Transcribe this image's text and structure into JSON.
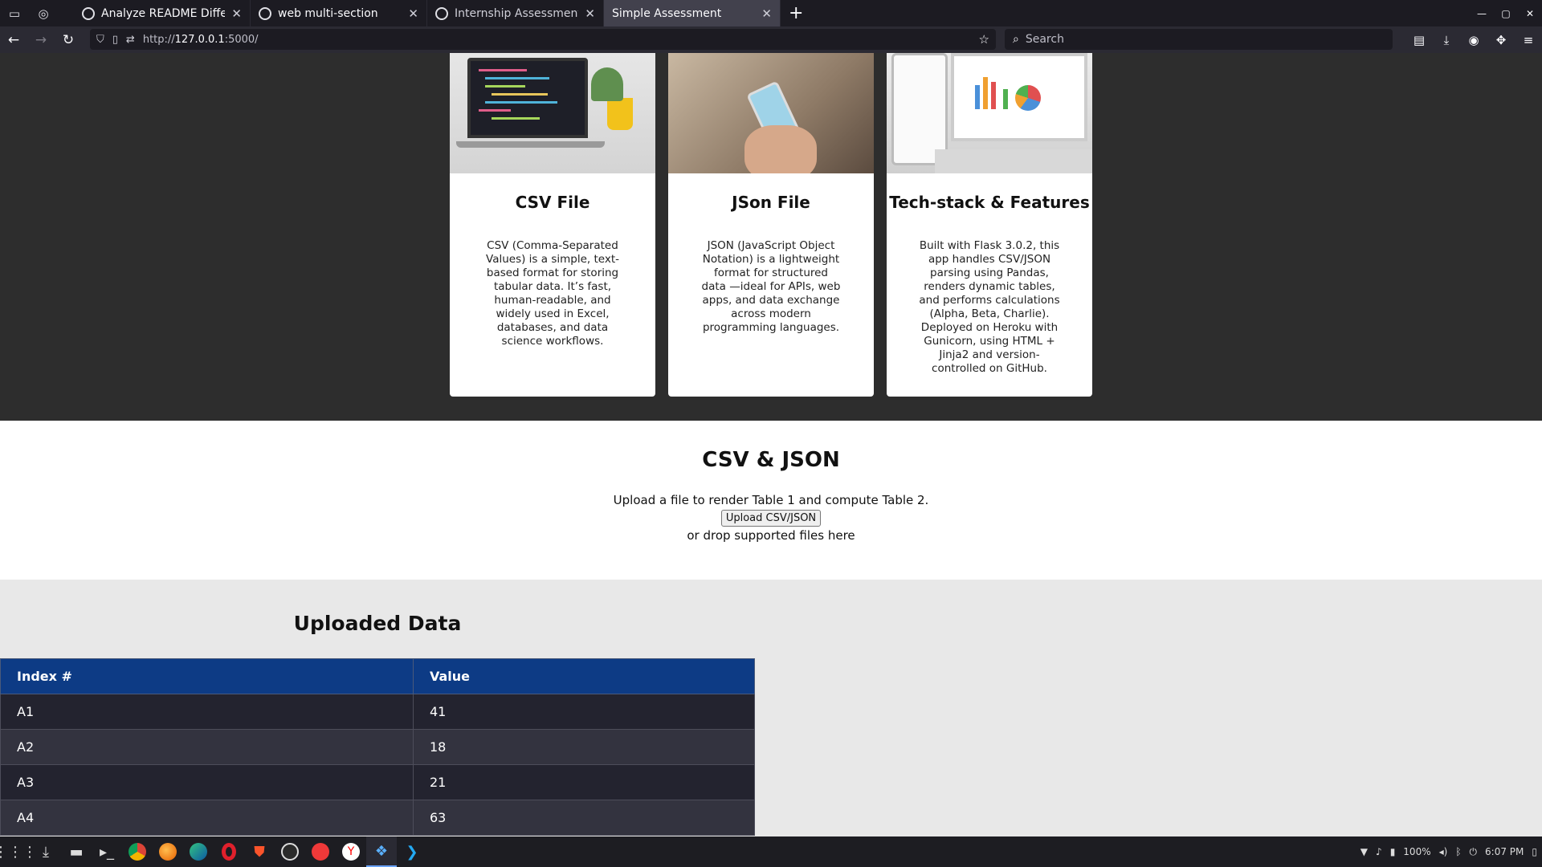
{
  "browser": {
    "tabs": [
      {
        "label": "Analyze README Differences",
        "active": false
      },
      {
        "label": "web multi-section",
        "active": false
      },
      {
        "label": "Internship Assessment Analy",
        "active": false
      },
      {
        "label": "Simple Assessment",
        "active": true
      }
    ],
    "url_prefix": "http://",
    "url_host": "127.0.0.1",
    "url_rest": ":5000/",
    "search_placeholder": "Search"
  },
  "cards": [
    {
      "title": "CSV File",
      "text": "CSV (Comma-Separated Values) is a simple, text-based format for storing tabular data. It’s fast, human-readable, and widely used in Excel, databases, and data science workflows."
    },
    {
      "title": "JSon File",
      "text": "JSON (JavaScript Object Notation) is a lightweight format for structured data —ideal for APIs, web apps, and data exchange across modern programming languages."
    },
    {
      "title": "Tech-stack & Features",
      "text": "Built with Flask 3.0.2, this app handles CSV/JSON parsing using Pandas, renders dynamic tables, and performs calculations (Alpha, Beta, Charlie). Deployed on Heroku with Gunicorn, using HTML + Jinja2 and version-controlled on GitHub."
    }
  ],
  "upload": {
    "title": "CSV & JSON",
    "description": "Upload a file to render Table 1 and compute Table 2.",
    "button_label": "Upload CSV/JSON",
    "drop_text": "or drop supported files here"
  },
  "data_table": {
    "title": "Uploaded Data",
    "columns": [
      "Index #",
      "Value"
    ],
    "rows": [
      [
        "A1",
        "41"
      ],
      [
        "A2",
        "18"
      ],
      [
        "A3",
        "21"
      ],
      [
        "A4",
        "63"
      ]
    ]
  },
  "taskbar": {
    "battery": "100%",
    "clock": "6:07 PM"
  },
  "colors": {
    "table_header": "#0d3b85",
    "page_dark": "#2d2d2d"
  }
}
